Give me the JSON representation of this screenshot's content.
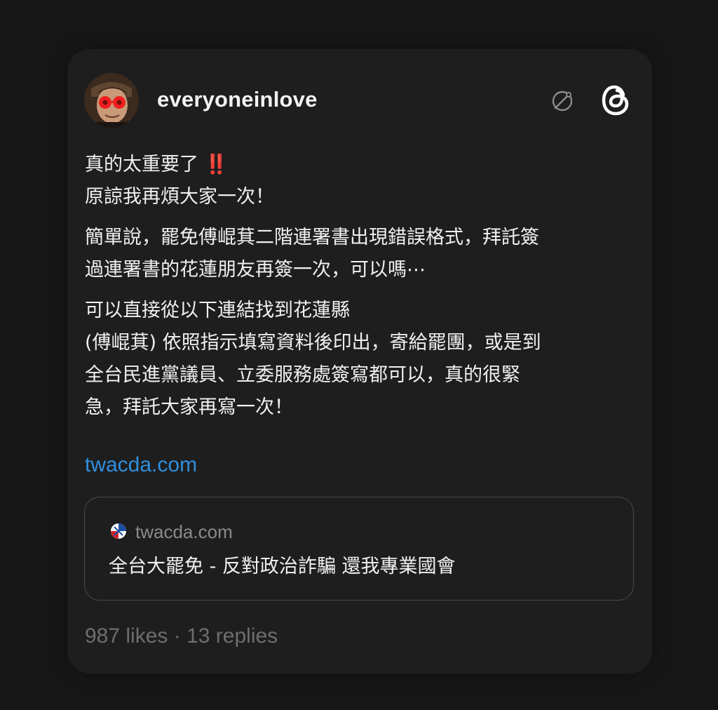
{
  "post": {
    "username": "everyoneinlove",
    "paragraphs": [
      [
        "真的太重要了",
        "原諒我再煩大家一次！"
      ],
      [
        "簡單說，罷免傅崐萁二階連署書出現錯誤格式，拜託簽",
        "過連署書的花蓮朋友再簽一次，可以嗎⋯"
      ],
      [
        "可以直接從以下連結找到花蓮縣",
        "(傅崐萁) 依照指示填寫資料後印出，寄給罷團，或是到",
        "全台民進黨議員、立委服務處簽寫都可以，真的很緊",
        "急，拜託大家再寫一次！"
      ]
    ],
    "emphasis_glyph": "‼️",
    "link_text": "twacda.com"
  },
  "link_preview": {
    "domain": "twacda.com",
    "title": "全台大罷免 - 反對政治詐騙 還我專業國會"
  },
  "stats": {
    "likes": "987 likes",
    "separator": "·",
    "replies": "13 replies"
  },
  "icons": {
    "hidden": "hidden-eye-icon",
    "brand": "threads-logo-icon"
  },
  "colors": {
    "background": "#171717",
    "card": "#1e1e1e",
    "link": "#2f8fde",
    "emphasis": "#e0312b"
  }
}
